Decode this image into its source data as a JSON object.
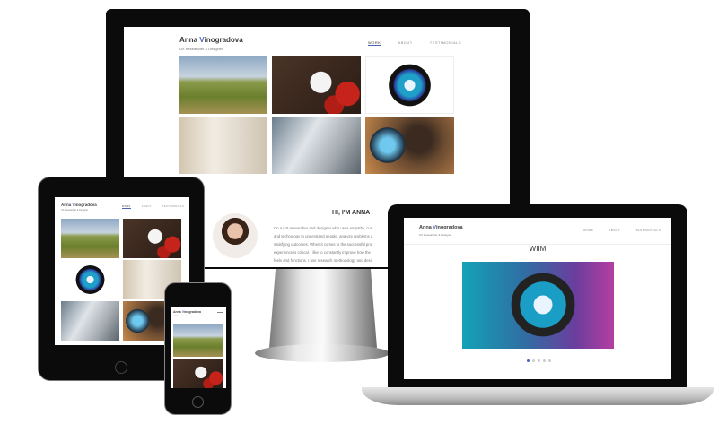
{
  "site": {
    "name_first": "Anna ",
    "name_v": "V",
    "name_rest": "inogradova",
    "subtitle": "UX Researcher & Designer"
  },
  "nav": {
    "work": "WORK",
    "about": "ABOUT",
    "testimonials": "TESTIMONIALS"
  },
  "about": {
    "heading": "HI, I'M ANNA",
    "lines": [
      "I'm a UX researcher and designer who uses empathy, curi",
      "and technology to understand people, analyze problems a",
      "satisfying outcomes. When it comes to the successful pro",
      "experience is critical. I like to constantly improve how the",
      "feels and functions. I use research methodology and desi"
    ]
  },
  "project": {
    "title": "WIIM",
    "carousel_dots": 5,
    "active_dot": 1
  },
  "colors": {
    "accent": "#4a62b8"
  }
}
